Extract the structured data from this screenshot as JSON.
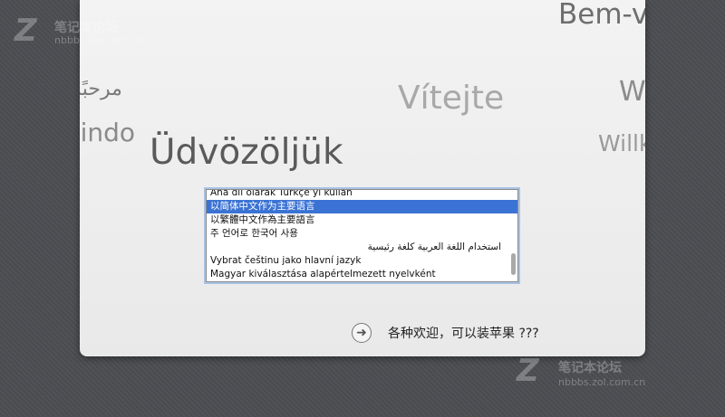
{
  "greetings": [
    "Bem-v",
    "مرحبًا",
    "Vítejte",
    "W",
    "vindo",
    "Willk",
    "Üdvözöljük"
  ],
  "language_list": {
    "items": [
      "Ana dil olarak Türkçe’yi kullan",
      "以简体中文作为主要语言",
      "以繁體中文作為主要語言",
      "주 언어로 한국어 사용",
      "استخدام اللغة العربية كلغة رئيسية",
      "Vybrat češtinu jako hlavní jazyk",
      "Magyar kiválasztása alapértelmezett nyelvként"
    ],
    "selected_index": 1
  },
  "continue": {
    "icon": "right-arrow-circle-icon",
    "label": "各种欢迎，可以装苹果 ???"
  },
  "watermarks": {
    "top_logo": "Z",
    "top_line1": "笔记本论坛",
    "top_line2": "nbbbs.zol.com.cn",
    "bottom_logo": "Z",
    "bottom_line1": "笔记本论坛",
    "bottom_line2": "nbbbs.zol.com.cn"
  }
}
